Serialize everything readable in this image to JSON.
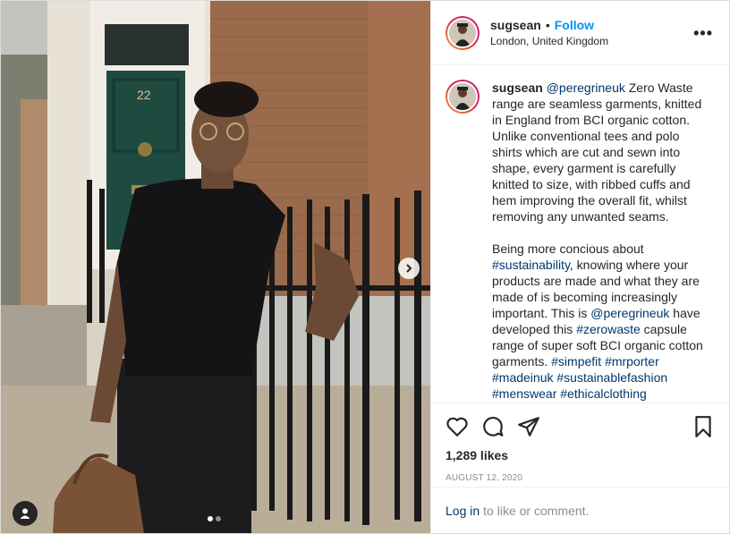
{
  "post": {
    "username": "sugsean",
    "separator": "•",
    "follow_label": "Follow",
    "location": "London, United Kingdom",
    "more_label": "•••",
    "door_number": "22"
  },
  "caption": {
    "username": "sugsean",
    "p1_mention": "@peregrineuk",
    "p1_text": " Zero Waste range are seamless garments, knitted in England from BCI organic cotton. Unlike conventional tees and polo shirts which are cut and sewn into shape, every garment is carefully knitted to size, with ribbed cuffs and hem improving the overall fit, whilst removing any unwanted seams.",
    "p2_a": "Being more concious about ",
    "p2_tag1": "#sustainability",
    "p2_b": ", knowing where your products are made and what they are made of is becoming increasingly important. This is ",
    "p2_mention": "@peregrineuk",
    "p2_c": " have developed this ",
    "p2_tag2": "#zerowaste",
    "p2_d": " capsule range of super soft BCI organic cotton garments. ",
    "p2_tag3": "#simpefit",
    "p2_tag4": "#mrporter",
    "p2_tag5": "#madeinuk",
    "p2_tag6": "#sustainablefashion",
    "p2_tag7": "#menswear",
    "p2_tag8": "#ethicalclothing"
  },
  "engagement": {
    "likes": "1,289 likes",
    "date": "AUGUST 12, 2020"
  },
  "login": {
    "link": "Log in",
    "text": "to like or comment."
  },
  "icons": {
    "like": "heart-icon",
    "comment": "comment-icon",
    "share": "paper-plane-icon",
    "save": "bookmark-icon",
    "next": "chevron-right-icon",
    "tag": "user-tag-icon"
  },
  "carousel": {
    "current": 1,
    "total": 2
  }
}
